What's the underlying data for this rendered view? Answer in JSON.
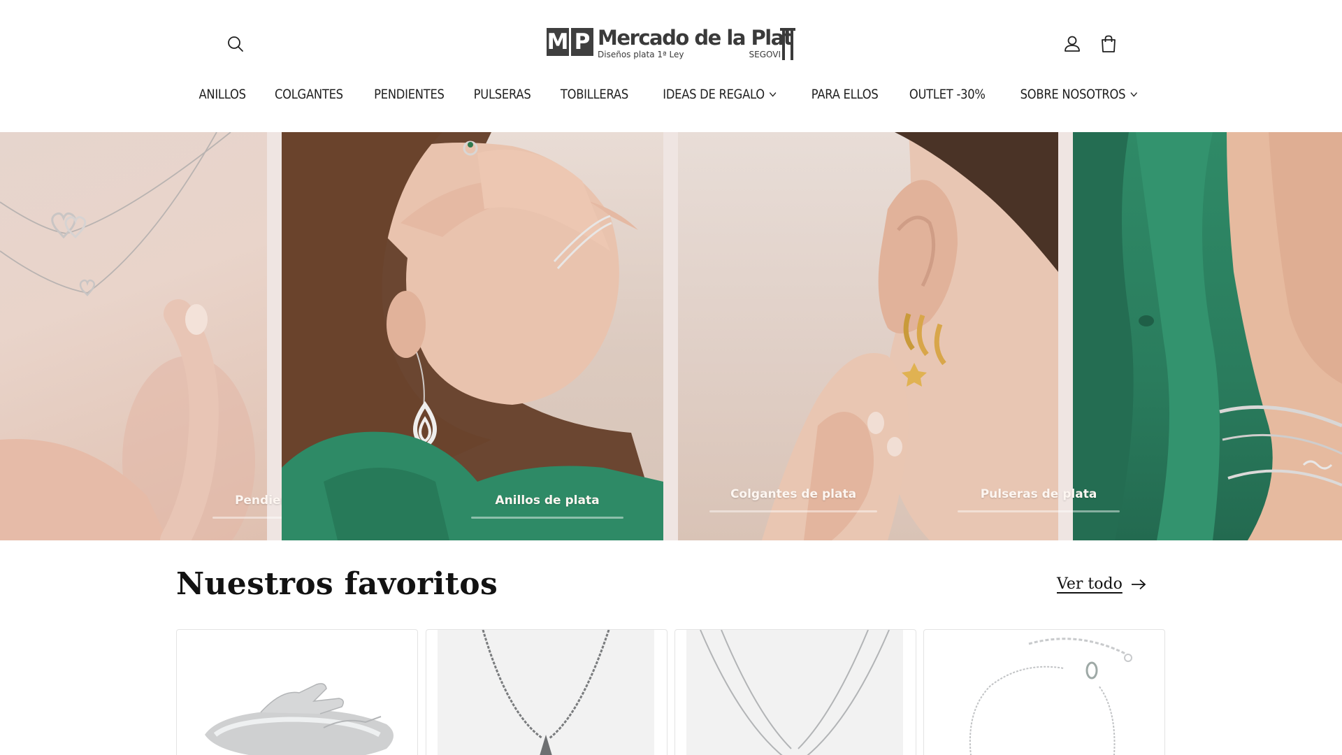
{
  "header": {
    "logo": {
      "mark_letters": [
        "M",
        "P"
      ],
      "name": "Mercado de la Plat",
      "tagline": "Diseños plata 1ª Ley",
      "location": "SEGOVI"
    },
    "icons": {
      "search": "search-icon",
      "account": "user-icon",
      "cart": "shopping-bag-icon"
    }
  },
  "nav": {
    "items": [
      {
        "label": "ANILLOS",
        "has_dropdown": false
      },
      {
        "label": "COLGANTES",
        "has_dropdown": false
      },
      {
        "label": "PENDIENTES",
        "has_dropdown": false
      },
      {
        "label": "PULSERAS",
        "has_dropdown": false
      },
      {
        "label": "TOBILLERAS",
        "has_dropdown": false
      },
      {
        "label": "IDEAS DE REGALO",
        "has_dropdown": true
      },
      {
        "label": "PARA ELLOS",
        "has_dropdown": false
      },
      {
        "label": "OUTLET -30%",
        "has_dropdown": false
      },
      {
        "label": "SOBRE NOSOTROS",
        "has_dropdown": true
      }
    ]
  },
  "hero": {
    "links": [
      {
        "label": "Pendientes de plata"
      },
      {
        "label": "Anillos de plata"
      },
      {
        "label": "Colgantes de plata"
      },
      {
        "label": "Pulseras de plata"
      }
    ]
  },
  "favorites": {
    "title": "Nuestros favoritos",
    "view_all": "Ver todo"
  },
  "colors": {
    "text": "#121212",
    "hero_green": "#2a7c5d",
    "hero_skin": "#e6d5cd",
    "border": "#e3e3e3"
  }
}
